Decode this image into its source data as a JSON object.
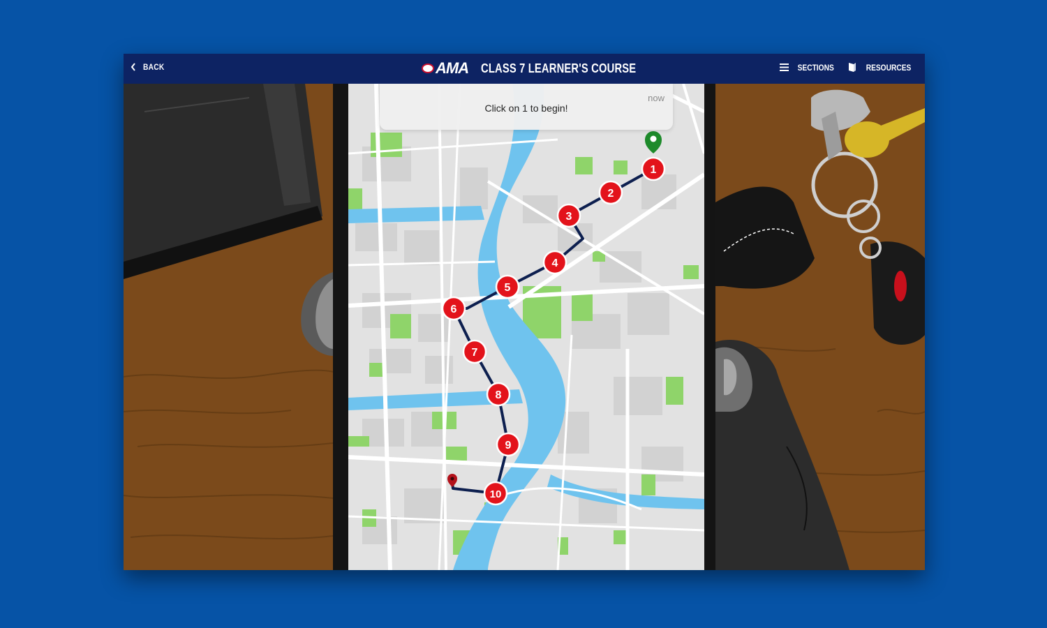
{
  "header": {
    "back_label": "BACK",
    "logo_text": "AMA",
    "course_title": "CLASS 7 LEARNER'S COURSE",
    "sections_label": "SECTIONS",
    "resources_label": "RESOURCES"
  },
  "notification": {
    "message": "Click on 1 to begin!",
    "time": "now"
  },
  "route": {
    "stops": [
      "1",
      "2",
      "3",
      "4",
      "5",
      "6",
      "7",
      "8",
      "9",
      "10"
    ]
  },
  "colors": {
    "background": "#0653a6",
    "header": "#0d2363",
    "stop_marker": "#e3131b",
    "route_line": "#0d1f4f",
    "start_pin": "#1d8a2a",
    "end_pin": "#b3121b",
    "water": "#6fc3ee",
    "park": "#8fd46a"
  }
}
